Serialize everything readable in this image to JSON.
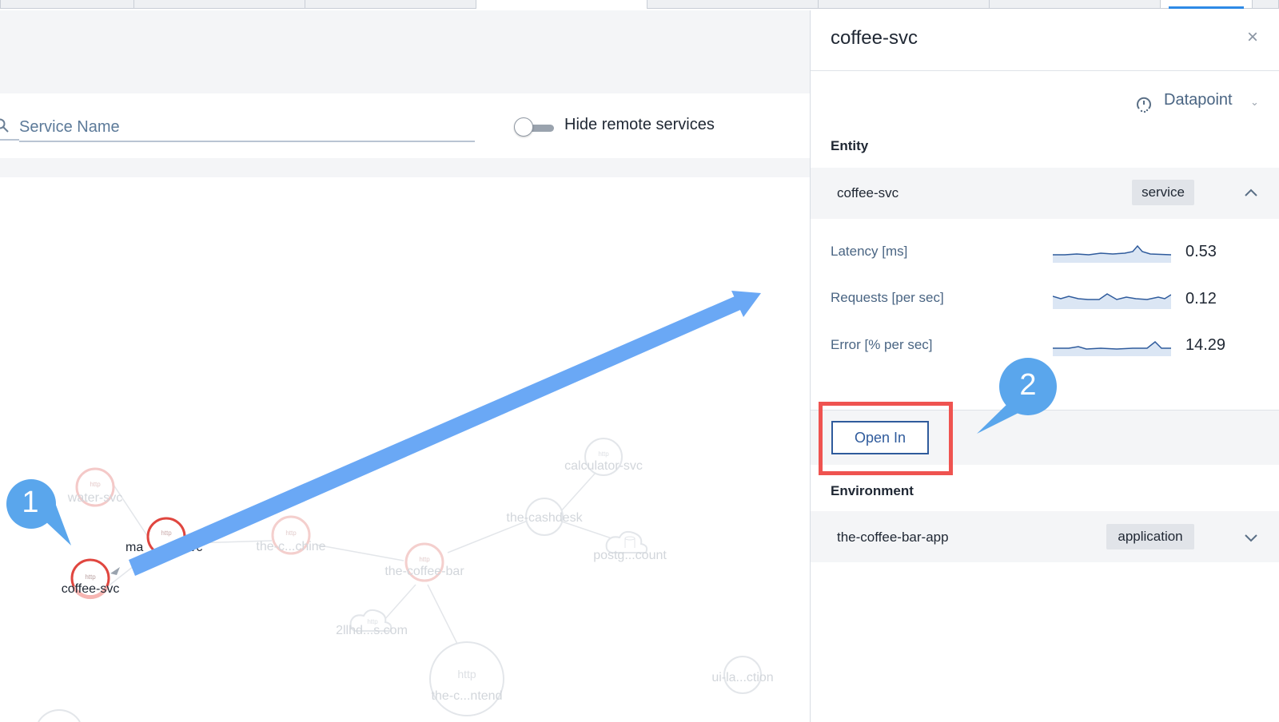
{
  "search": {
    "placeholder": "Service Name"
  },
  "toggle": {
    "label": "Hide remote services",
    "on": false
  },
  "graph": {
    "nodes": [
      {
        "label": "water-svc",
        "kind": "http",
        "faded": true
      },
      {
        "label": "ma",
        "kind": "http",
        "faded": false
      },
      {
        "label": "-svc",
        "kind": "http",
        "faded": false
      },
      {
        "label": "coffee-svc",
        "kind": "http",
        "faded": false
      },
      {
        "label": "the-c...chine",
        "kind": "http",
        "faded": true
      },
      {
        "label": "the-coffee-bar",
        "kind": "http",
        "faded": true
      },
      {
        "label": "the-cashdesk",
        "kind": "http",
        "faded": true
      },
      {
        "label": "calculator-svc",
        "kind": "http",
        "faded": true
      },
      {
        "label": "postg...count",
        "kind": "db",
        "faded": true
      },
      {
        "label": "2llhd...s.com",
        "kind": "remote",
        "faded": true
      },
      {
        "label": "the-c...ntend",
        "kind": "http",
        "faded": true
      },
      {
        "label": "ui-la...ction",
        "kind": "http",
        "faded": true
      }
    ],
    "node_kind_label": "http"
  },
  "panel": {
    "title": "coffee-svc",
    "close_icon": "close-icon",
    "datapoint_label": "Datapoint",
    "entity_heading": "Entity",
    "entity": {
      "name": "coffee-svc",
      "tag": "service",
      "expanded": true
    },
    "metrics": [
      {
        "label": "Latency [ms]",
        "value": "0.53"
      },
      {
        "label": "Requests [per sec]",
        "value": "0.12"
      },
      {
        "label": "Error [% per sec]",
        "value": "14.29"
      }
    ],
    "open_in_label": "Open In",
    "environment_heading": "Environment",
    "environment": {
      "name": "the-coffee-bar-app",
      "tag": "application",
      "expanded": false
    }
  },
  "annotations": {
    "badge1": "1",
    "badge2": "2",
    "arrow_color": "#6aa8f5",
    "badge_color": "#5aa6ec",
    "highlight_color": "#ef5350"
  }
}
